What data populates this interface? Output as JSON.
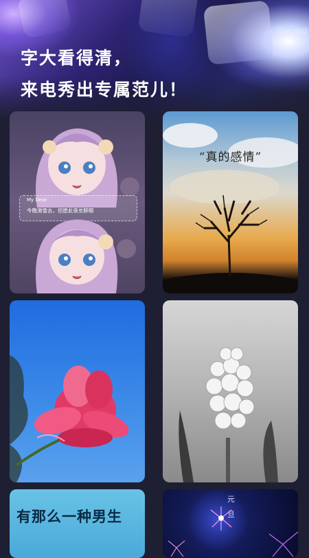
{
  "header": {
    "id_label": "IDle26d2",
    "headline_line1": "字大看得清，",
    "headline_line2": "来电秀出专属范儿！"
  },
  "cards": [
    {
      "name": "anime-girl",
      "banner_title": "My Dear",
      "banner_text": "今晚滑雪去，但愿此夜长醉眼"
    },
    {
      "name": "tree-sunset",
      "caption": "“真的感情”"
    },
    {
      "name": "pink-lotus"
    },
    {
      "name": "white-hyacinth"
    },
    {
      "name": "boy-text",
      "caption": "有那么一种男生"
    },
    {
      "name": "fireworks",
      "char1": "元",
      "char2": "旦"
    }
  ]
}
